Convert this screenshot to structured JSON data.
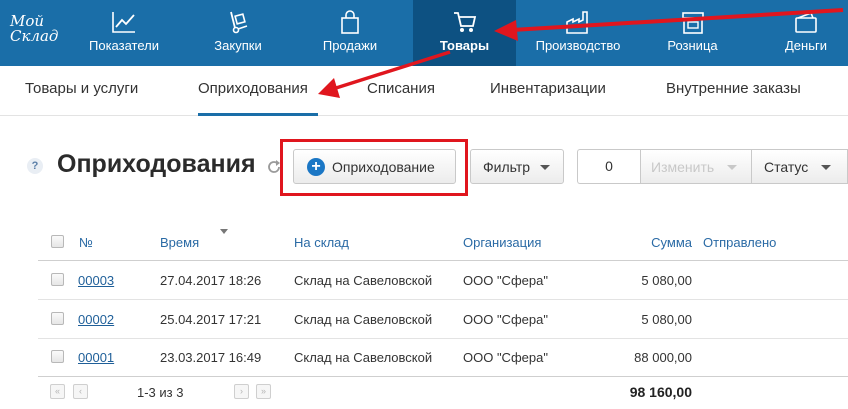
{
  "logo": {
    "line1": "Мой",
    "line2": "Склад"
  },
  "topnav": {
    "items": [
      {
        "label": "Показатели",
        "icon": "chart-icon"
      },
      {
        "label": "Закупки",
        "icon": "hand-truck-icon"
      },
      {
        "label": "Продажи",
        "icon": "shopping-bag-icon"
      },
      {
        "label": "Товары",
        "icon": "cart-icon",
        "active": true
      },
      {
        "label": "Производство",
        "icon": "factory-icon"
      },
      {
        "label": "Розница",
        "icon": "storefront-icon"
      },
      {
        "label": "Деньги",
        "icon": "wallet-icon"
      }
    ]
  },
  "subnav": {
    "tabs": [
      {
        "label": "Товары и услуги"
      },
      {
        "label": "Оприходования",
        "active": true
      },
      {
        "label": "Списания"
      },
      {
        "label": "Инвентаризации"
      },
      {
        "label": "Внутренние заказы"
      }
    ]
  },
  "toolbar": {
    "help": "?",
    "title": "Оприходования",
    "add_button": "Оприходование",
    "filter_button": "Фильтр",
    "selected_count": "0",
    "change_button": "Изменить",
    "status_button": "Статус"
  },
  "table": {
    "columns": [
      "№",
      "Время",
      "На склад",
      "Организация",
      "Сумма",
      "Отправлено"
    ],
    "rows": [
      {
        "number": "00003",
        "time": "27.04.2017 18:26",
        "warehouse": "Склад на Савеловской",
        "organization": "ООО \"Сфера\"",
        "sum": "5 080,00"
      },
      {
        "number": "00002",
        "time": "25.04.2017 17:21",
        "warehouse": "Склад на Савеловской",
        "organization": "ООО \"Сфера\"",
        "sum": "5 080,00"
      },
      {
        "number": "00001",
        "time": "23.03.2017 16:49",
        "warehouse": "Склад на Савеловской",
        "organization": "ООО \"Сфера\"",
        "sum": "88 000,00"
      }
    ]
  },
  "footer": {
    "pager_text": "1-3 из 3",
    "total": "98 160,00"
  },
  "colors": {
    "nav_bg": "#1a6ea8",
    "nav_active_bg": "#0d5182",
    "link": "#1f5f99",
    "highlight_red": "#e0161e"
  }
}
